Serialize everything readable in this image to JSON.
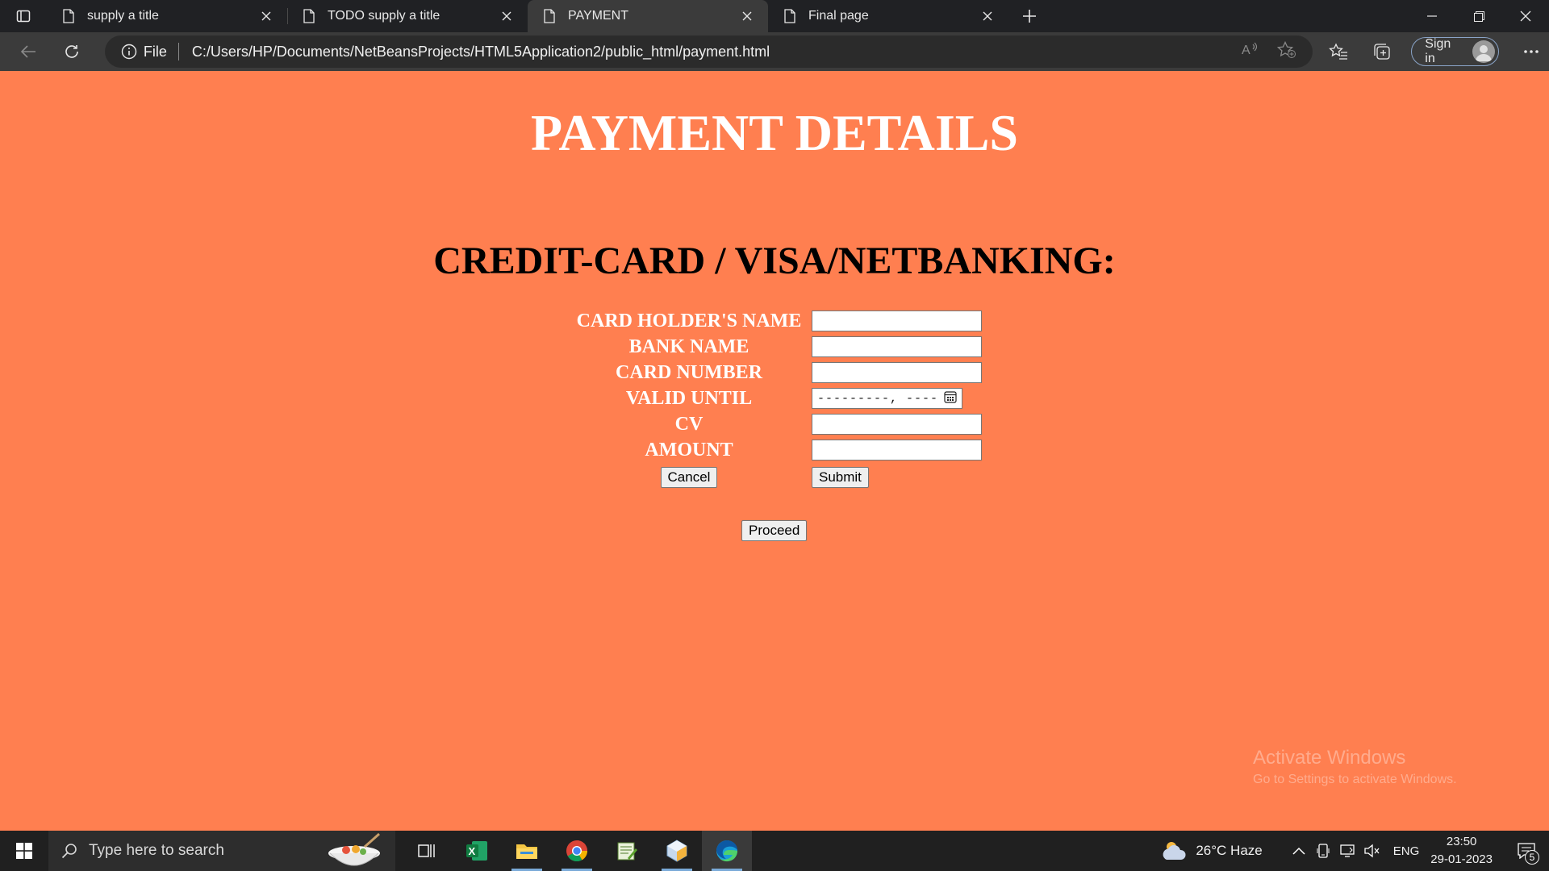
{
  "browser": {
    "tabs": [
      {
        "label": "supply a title",
        "active": false
      },
      {
        "label": "TODO supply a title",
        "active": false
      },
      {
        "label": "PAYMENT",
        "active": true
      },
      {
        "label": "Final page",
        "active": false
      }
    ],
    "address": {
      "scheme_label": "File",
      "url": "C:/Users/HP/Documents/NetBeansProjects/HTML5Application2/public_html/payment.html"
    },
    "sign_in_label": "Sign in"
  },
  "page": {
    "title": "PAYMENT DETAILS",
    "subtitle": "CREDIT-CARD / VISA/NETBANKING:",
    "form": {
      "card_holder_label": "CARD HOLDER'S NAME",
      "card_holder_value": "",
      "bank_name_label": "BANK NAME",
      "bank_name_value": "",
      "card_number_label": "CARD NUMBER",
      "card_number_value": "",
      "valid_until_label": "VALID UNTIL",
      "valid_until_placeholder": "---------, ----",
      "cv_label": "CV",
      "cv_value": "",
      "amount_label": "AMOUNT",
      "amount_value": "",
      "cancel_label": "Cancel",
      "submit_label": "Submit"
    },
    "proceed_label": "Proceed"
  },
  "watermark": {
    "line1": "Activate Windows",
    "line2": "Go to Settings to activate Windows."
  },
  "taskbar": {
    "search_placeholder": "Type here to search",
    "apps": [
      "task-view-icon",
      "excel-icon",
      "file-explorer-icon",
      "chrome-icon",
      "notepad-icon",
      "netbeans-icon",
      "edge-icon"
    ],
    "weather": "26°C  Haze",
    "language": "ENG",
    "time": "23:50",
    "date": "29-01-2023",
    "notification_count": "5"
  },
  "colors": {
    "page_background": "#ff7f50",
    "title_color": "#ffffff",
    "subtitle_color": "#000000",
    "label_color": "#ffffff"
  }
}
